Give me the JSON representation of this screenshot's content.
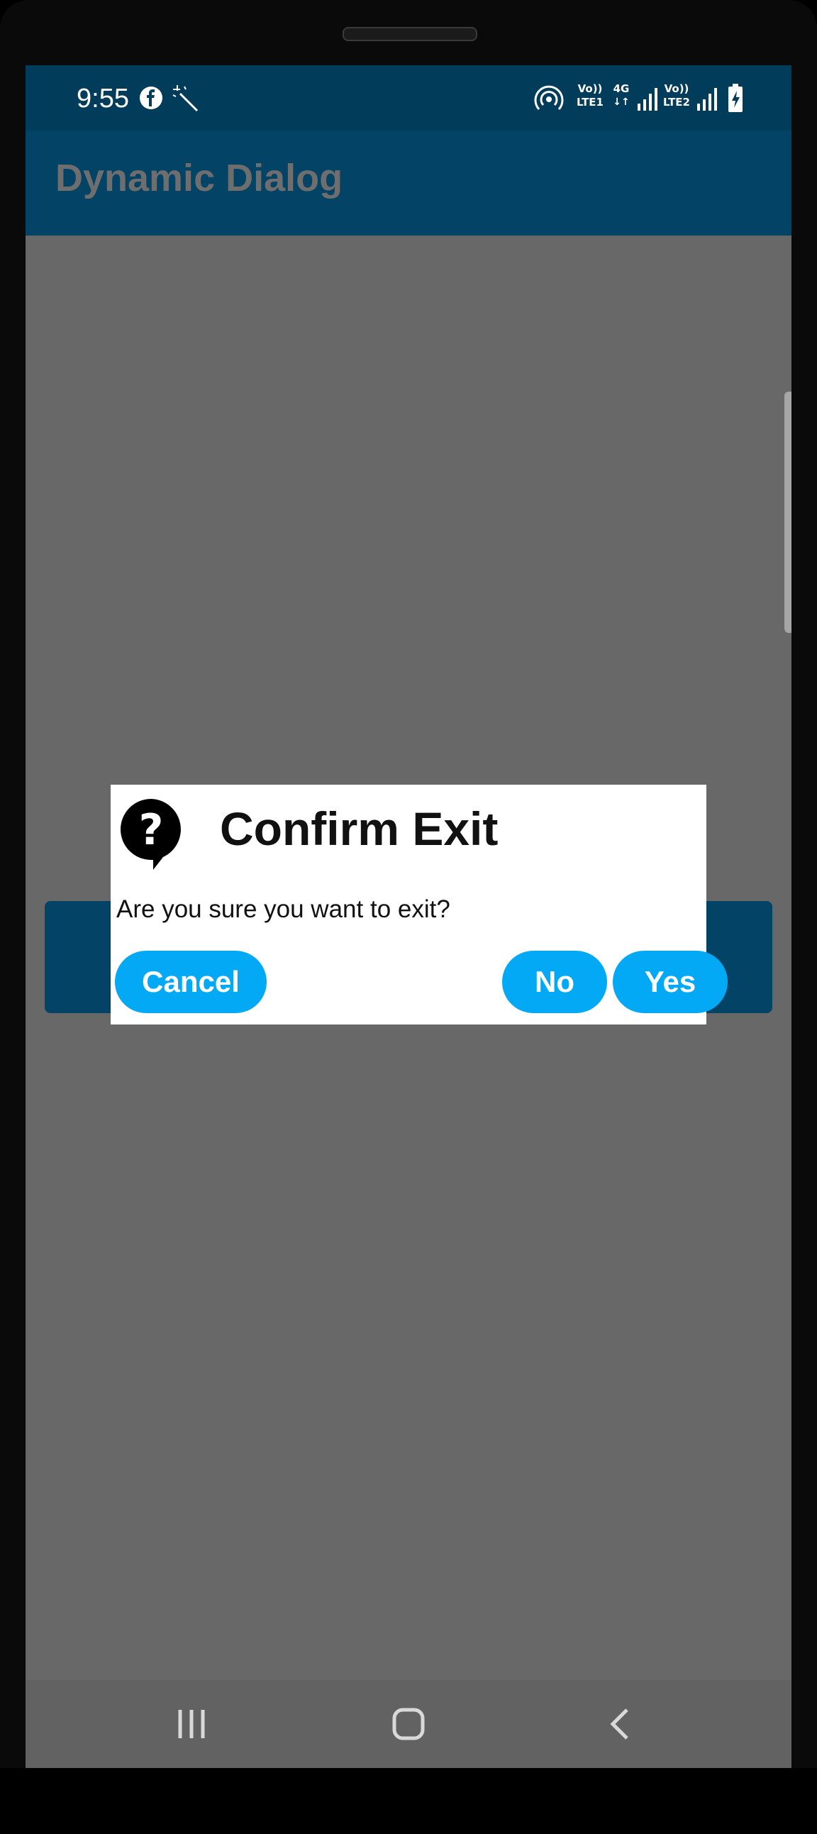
{
  "status_bar": {
    "time": "9:55",
    "icons": [
      "facebook-icon",
      "magic-wand-icon",
      "hotspot-icon",
      "volte-lte1-icon",
      "signal-4g-icon",
      "volte-lte2-icon",
      "signal-icon",
      "battery-charging-icon"
    ],
    "lte1_label": "LTE1",
    "lte2_label": "LTE2",
    "vo_label": "Vo))",
    "net_label": "4G"
  },
  "app_bar": {
    "title": "Dynamic Dialog"
  },
  "dialog": {
    "icon": "question-bubble-icon",
    "title": "Confirm Exit",
    "message": "Are you sure you want to exit?",
    "buttons": {
      "cancel": "Cancel",
      "no": "No",
      "yes": "Yes"
    },
    "button_color": "#03a9f4"
  },
  "nav_bar": {
    "icons": [
      "recent-apps-icon",
      "home-icon",
      "back-icon"
    ]
  },
  "colors": {
    "status_bar": "#023c5b",
    "app_bar": "#024366",
    "scrim": "#686868"
  }
}
